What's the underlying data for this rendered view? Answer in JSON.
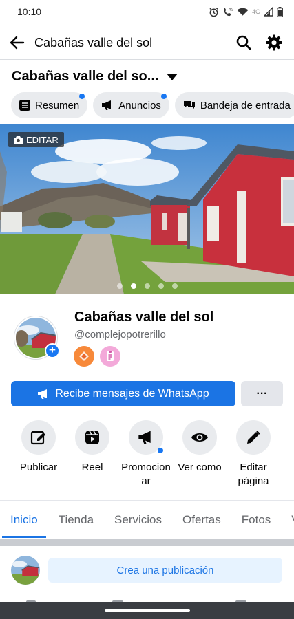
{
  "status_bar": {
    "time": "10:10",
    "icons": [
      "alarm-icon",
      "wifi-calling-icon",
      "wifi-icon",
      "signal-4g-icon",
      "battery-icon"
    ],
    "network_label": "4G"
  },
  "app_bar": {
    "title": "Cabañas valle del sol",
    "icons": [
      "back-arrow-icon",
      "search-icon",
      "gear-icon"
    ]
  },
  "page_selector": {
    "name": "Cabañas valle del so...",
    "icon": "caret-down-icon"
  },
  "chips": [
    {
      "label": "Resumen",
      "icon": "list-icon",
      "has_dot": true
    },
    {
      "label": "Anuncios",
      "icon": "megaphone-icon",
      "has_dot": true
    },
    {
      "label": "Bandeja de entrada",
      "icon": "chat-icon",
      "has_dot": false
    }
  ],
  "cover": {
    "edit_label": "EDITAR",
    "edit_icon": "camera-icon",
    "carousel_count": 5,
    "carousel_active": 1
  },
  "profile": {
    "name": "Cabañas valle del sol",
    "handle": "@complejopotrerillo",
    "add_icon": "plus-icon",
    "badges": [
      "orange-badge-icon",
      "pink-badge-icon"
    ]
  },
  "cta": {
    "label": "Recibe mensajes de WhatsApp",
    "icon": "megaphone-icon",
    "more_label": "···"
  },
  "actions": [
    {
      "label": "Publicar",
      "icon": "compose-icon",
      "has_dot": false
    },
    {
      "label": "Reel",
      "icon": "reel-icon",
      "has_dot": false
    },
    {
      "label": "Promocion\nar",
      "icon": "megaphone-icon",
      "has_dot": true
    },
    {
      "label": "Ver como",
      "icon": "eye-icon",
      "has_dot": false
    },
    {
      "label": "Editar\npágina",
      "icon": "pencil-icon",
      "has_dot": false
    }
  ],
  "tabs": [
    "Inicio",
    "Tienda",
    "Servicios",
    "Ofertas",
    "Fotos",
    "V"
  ],
  "active_tab": "Inicio",
  "composer": {
    "button_label": "Crea una publicación"
  },
  "colors": {
    "brand_blue": "#1b74e4",
    "chip_bg": "#e9ebee",
    "secondary_text": "#65676b"
  }
}
